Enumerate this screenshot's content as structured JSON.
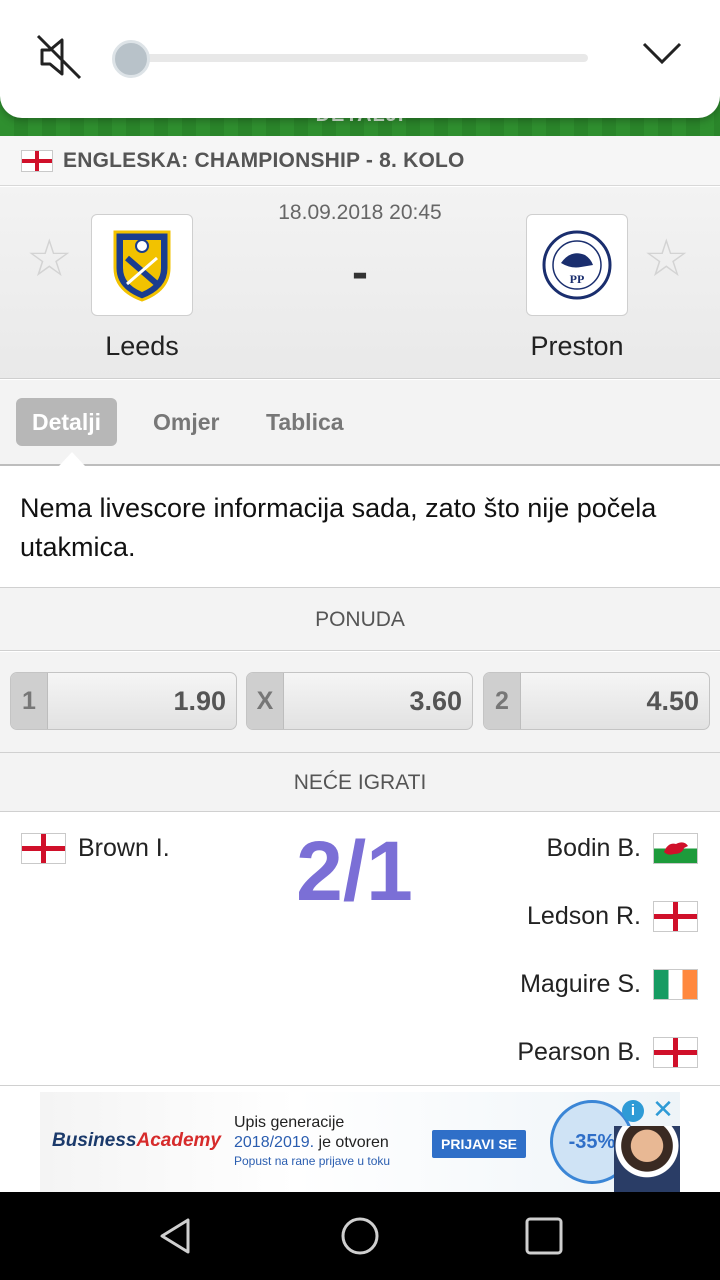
{
  "header": {
    "peek_label": "DETALJI"
  },
  "volume": {
    "level": 0.0,
    "mute_icon": "mute-icon",
    "collapse_icon": "chevron-down-icon"
  },
  "league": {
    "flag": "england",
    "name": "ENGLESKA: CHAMPIONSHIP - 8. KOLO"
  },
  "match": {
    "datetime": "18.09.2018 20:45",
    "score": "-",
    "home": {
      "name": "Leeds",
      "logo": "leeds-crest-icon"
    },
    "away": {
      "name": "Preston",
      "logo": "preston-crest-icon"
    }
  },
  "tabs": [
    {
      "label": "Detalji",
      "active": true
    },
    {
      "label": "Omjer",
      "active": false
    },
    {
      "label": "Tablica",
      "active": false
    }
  ],
  "info_message": "Nema livescore informacija sada, zato što nije počela utakmica.",
  "offer": {
    "title": "PONUDA",
    "odds": [
      {
        "label": "1",
        "value": "1.90"
      },
      {
        "label": "X",
        "value": "3.60"
      },
      {
        "label": "2",
        "value": "4.50"
      }
    ]
  },
  "absent": {
    "title": "NEĆE IGRATI",
    "count": "2/1",
    "home": [
      {
        "name": "Brown I.",
        "flag": "england"
      }
    ],
    "away": [
      {
        "name": "Bodin B.",
        "flag": "wales"
      },
      {
        "name": "Ledson R.",
        "flag": "england"
      },
      {
        "name": "Maguire S.",
        "flag": "ireland"
      },
      {
        "name": "Pearson B.",
        "flag": "england"
      }
    ]
  },
  "ad": {
    "brand_part1": "Business",
    "brand_part2": "Academy",
    "line1": "Upis generacije",
    "line2_a": "2018/2019.",
    "line2_b": " je otvoren",
    "line3": "Popust na rane prijave u toku",
    "cta": "PRIJAVI SE",
    "badge": "-35%",
    "info": "i",
    "close": "✕"
  },
  "colors": {
    "accent_green": "#2f8f2f",
    "count_purple": "#7b6fd6",
    "flag_red": "#d0102a"
  }
}
